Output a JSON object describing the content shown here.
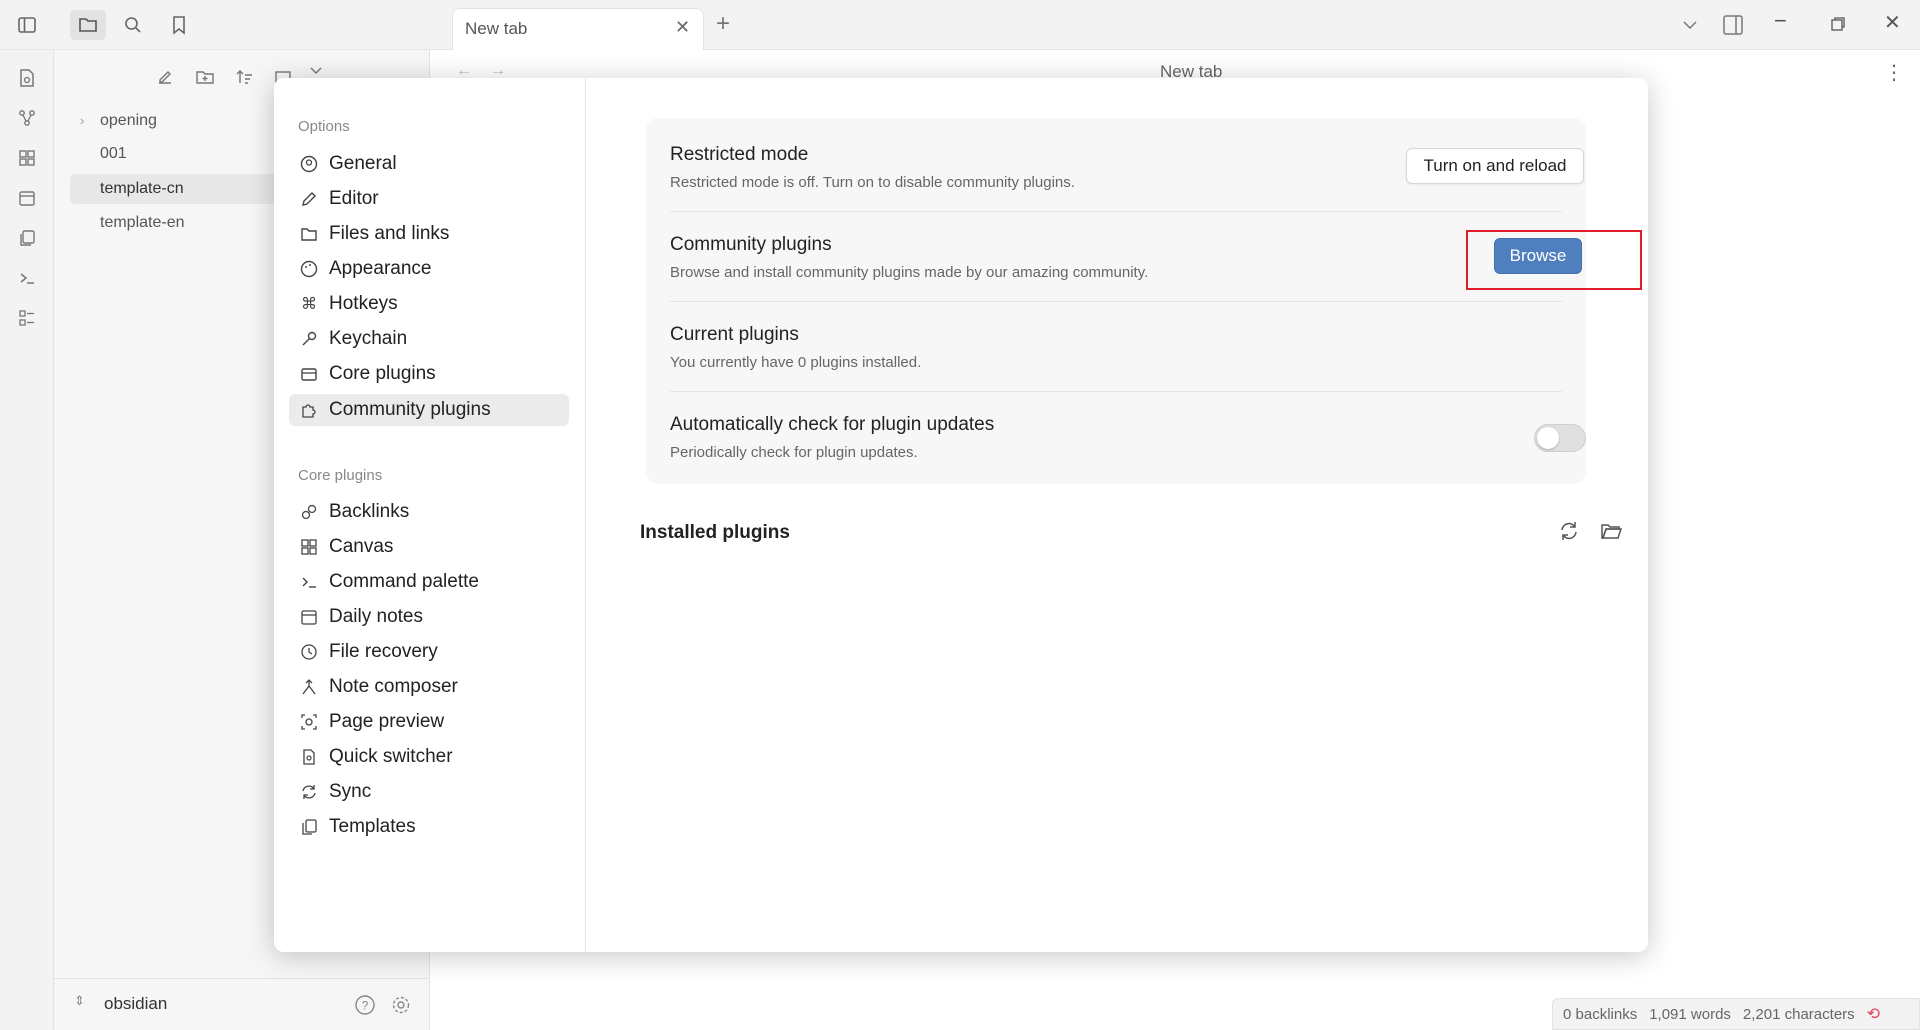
{
  "window": {
    "tab_title": "New tab",
    "view_title": "New tab"
  },
  "file_tree": {
    "items": [
      {
        "label": "opening",
        "folder": true
      },
      {
        "label": "001"
      },
      {
        "label": "template-cn",
        "active": true
      },
      {
        "label": "template-en"
      }
    ]
  },
  "vault": {
    "name": "obsidian"
  },
  "status": {
    "backlinks": "0 backlinks",
    "words": "1,091 words",
    "characters": "2,201 characters"
  },
  "settings": {
    "options_header": "Options",
    "options": [
      {
        "label": "General",
        "icon": "user-circle-icon"
      },
      {
        "label": "Editor",
        "icon": "pencil-icon"
      },
      {
        "label": "Files and links",
        "icon": "folder-cog-icon"
      },
      {
        "label": "Appearance",
        "icon": "palette-icon"
      },
      {
        "label": "Hotkeys",
        "icon": "command-icon"
      },
      {
        "label": "Keychain",
        "icon": "key-icon"
      },
      {
        "label": "Core plugins",
        "icon": "box-icon"
      },
      {
        "label": "Community plugins",
        "icon": "puzzle-icon",
        "selected": true
      }
    ],
    "core_header": "Core plugins",
    "core": [
      {
        "label": "Backlinks",
        "icon": "links-icon"
      },
      {
        "label": "Canvas",
        "icon": "grid-icon"
      },
      {
        "label": "Command palette",
        "icon": "terminal-icon"
      },
      {
        "label": "Daily notes",
        "icon": "calendar-icon"
      },
      {
        "label": "File recovery",
        "icon": "history-icon"
      },
      {
        "label": "Note composer",
        "icon": "merge-icon"
      },
      {
        "label": "Page preview",
        "icon": "eye-scan-icon"
      },
      {
        "label": "Quick switcher",
        "icon": "file-search-icon"
      },
      {
        "label": "Sync",
        "icon": "sync-icon"
      },
      {
        "label": "Templates",
        "icon": "copy-icon"
      }
    ]
  },
  "community": {
    "restricted_title": "Restricted mode",
    "restricted_desc": "Restricted mode is off. Turn on to disable community plugins.",
    "restricted_button": "Turn on and reload",
    "community_title": "Community plugins",
    "community_desc": "Browse and install community plugins made by our amazing community.",
    "browse_button": "Browse",
    "current_title": "Current plugins",
    "current_desc": "You currently have 0 plugins installed.",
    "auto_title": "Automatically check for plugin updates",
    "auto_desc": "Periodically check for plugin updates.",
    "auto_enabled": false,
    "installed_title": "Installed plugins"
  },
  "colors": {
    "accent": "#4f7fbf",
    "highlight": "#e11d2a"
  }
}
